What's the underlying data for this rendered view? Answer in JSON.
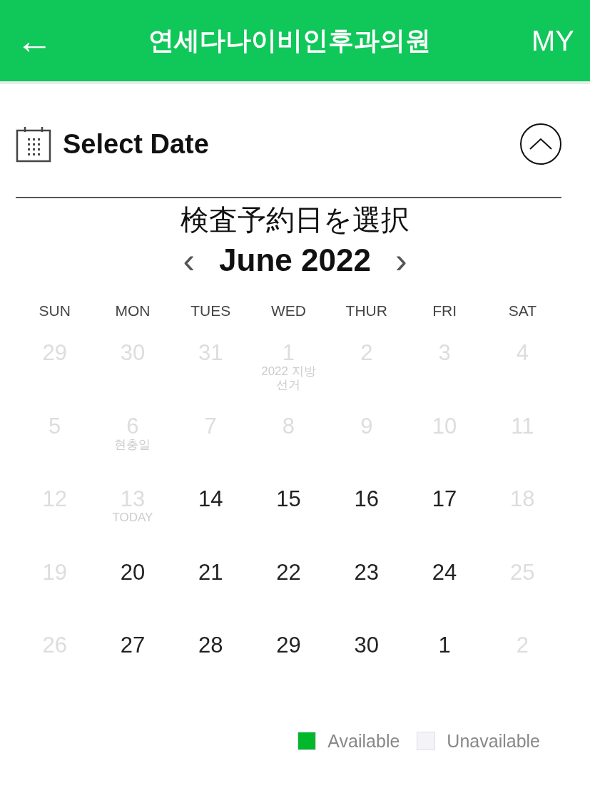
{
  "header": {
    "back": "←",
    "title": "연세다나이비인후과의원",
    "my": "MY"
  },
  "section": {
    "title": "Select Date",
    "expanded": true
  },
  "caption": "検査予約日を選択",
  "calendar": {
    "prev": "‹",
    "month": "June 2022",
    "next": "›",
    "weekdays": [
      "SUN",
      "MON",
      "TUES",
      "WED",
      "THUR",
      "FRI",
      "SAT"
    ],
    "weeks": [
      [
        {
          "day": "29",
          "available": false
        },
        {
          "day": "30",
          "available": false
        },
        {
          "day": "31",
          "available": false
        },
        {
          "day": "1",
          "available": false,
          "note": "2022 지방 선거"
        },
        {
          "day": "2",
          "available": false
        },
        {
          "day": "3",
          "available": false
        },
        {
          "day": "4",
          "available": false
        }
      ],
      [
        {
          "day": "5",
          "available": false
        },
        {
          "day": "6",
          "available": false,
          "note": "현충일"
        },
        {
          "day": "7",
          "available": false
        },
        {
          "day": "8",
          "available": false
        },
        {
          "day": "9",
          "available": false
        },
        {
          "day": "10",
          "available": false
        },
        {
          "day": "11",
          "available": false
        }
      ],
      [
        {
          "day": "12",
          "available": false
        },
        {
          "day": "13",
          "available": false,
          "note": "TODAY"
        },
        {
          "day": "14",
          "available": true
        },
        {
          "day": "15",
          "available": true
        },
        {
          "day": "16",
          "available": true
        },
        {
          "day": "17",
          "available": true
        },
        {
          "day": "18",
          "available": false
        }
      ],
      [
        {
          "day": "19",
          "available": false
        },
        {
          "day": "20",
          "available": true
        },
        {
          "day": "21",
          "available": true
        },
        {
          "day": "22",
          "available": true
        },
        {
          "day": "23",
          "available": true
        },
        {
          "day": "24",
          "available": true
        },
        {
          "day": "25",
          "available": false
        }
      ],
      [
        {
          "day": "26",
          "available": false
        },
        {
          "day": "27",
          "available": true
        },
        {
          "day": "28",
          "available": true
        },
        {
          "day": "29",
          "available": true
        },
        {
          "day": "30",
          "available": true
        },
        {
          "day": "1",
          "available": true
        },
        {
          "day": "2",
          "available": false
        }
      ]
    ]
  },
  "legend": [
    {
      "label": "Available",
      "color": "#00b82a"
    },
    {
      "label": "Unavailable",
      "color": "#f4f4f6"
    }
  ]
}
